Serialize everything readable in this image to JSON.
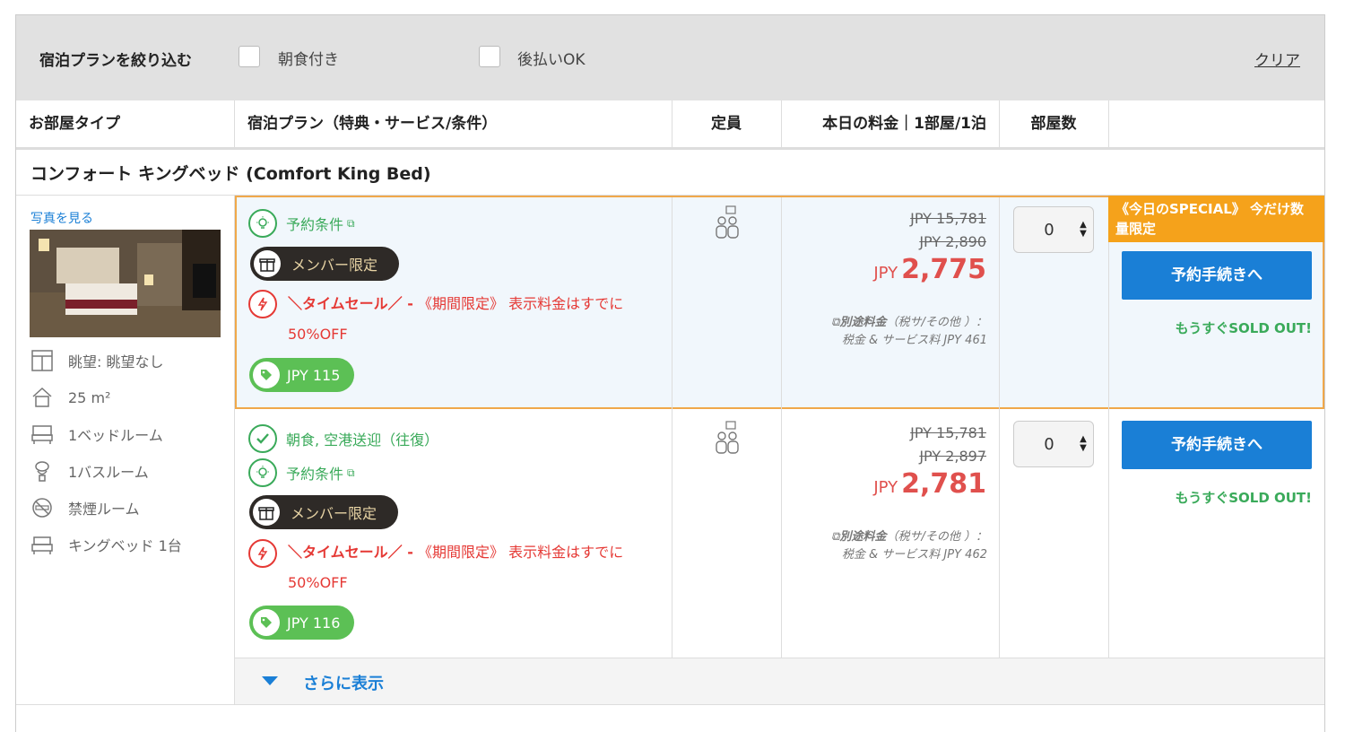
{
  "filter": {
    "title": "宿泊プランを絞り込む",
    "options": [
      {
        "label": "朝食付き",
        "checked": false
      },
      {
        "label": "後払いOK",
        "checked": false
      }
    ],
    "clear": "クリア"
  },
  "header": {
    "room_type": "お部屋タイプ",
    "plan": "宿泊プラン（特典・サービス/条件）",
    "capacity": "定員",
    "price": "本日の料金｜1部屋/1泊",
    "rooms": "部屋数"
  },
  "room": {
    "name": "コンフォート キングベッド (Comfort King Bed)",
    "photo_link": "写真を見る",
    "features": [
      {
        "icon": "window-view-icon",
        "label": "眺望: 眺望なし"
      },
      {
        "icon": "house-area-icon",
        "label": "25 m²"
      },
      {
        "icon": "bed-icon",
        "label": "1ベッドルーム"
      },
      {
        "icon": "toilet-icon",
        "label": "1バスルーム"
      },
      {
        "icon": "no-smoking-icon",
        "label": "禁煙ルーム"
      },
      {
        "icon": "king-bed-icon",
        "label": "キングベッド 1台"
      }
    ]
  },
  "plans": [
    {
      "included": null,
      "conditions": "予約条件",
      "member": "メンバー限定",
      "sale_bold": "＼タイムセール／ -",
      "sale_text": "《期間限定》 表示料金はすでに",
      "sale_text2": "50%OFF",
      "points": "JPY 115",
      "price_orig": "JPY 15,781",
      "price_mid": "JPY 2,890",
      "price_currency": "JPY",
      "price": "2,775",
      "tax_label": "別途料金",
      "tax_paren": "（税サ/その他 ）：",
      "tax_line": "税金 & サービス料 JPY 461",
      "qty": "0",
      "special": "《今日のSPECIAL》 今だけ数量限定",
      "book": "予約手続きへ",
      "soldout": "もうすぐSOLD OUT!"
    },
    {
      "included": "朝食, 空港送迎（往復）",
      "conditions": "予約条件",
      "member": "メンバー限定",
      "sale_bold": "＼タイムセール／ -",
      "sale_text": "《期間限定》 表示料金はすでに",
      "sale_text2": "50%OFF",
      "points": "JPY 116",
      "price_orig": "JPY 15,781",
      "price_mid": "JPY 2,897",
      "price_currency": "JPY",
      "price": "2,781",
      "tax_label": "別途料金",
      "tax_paren": "（税サ/その他 ）：",
      "tax_line": "税金 & サービス料 JPY 462",
      "qty": "0",
      "book": "予約手続きへ",
      "soldout": "もうすぐSOLD OUT!"
    }
  ],
  "more": "さらに表示",
  "colors": {
    "accent_blue": "#1a7fd6",
    "price_red": "#e0504d",
    "green": "#3aaa5a",
    "special_orange": "#f5a21b"
  }
}
